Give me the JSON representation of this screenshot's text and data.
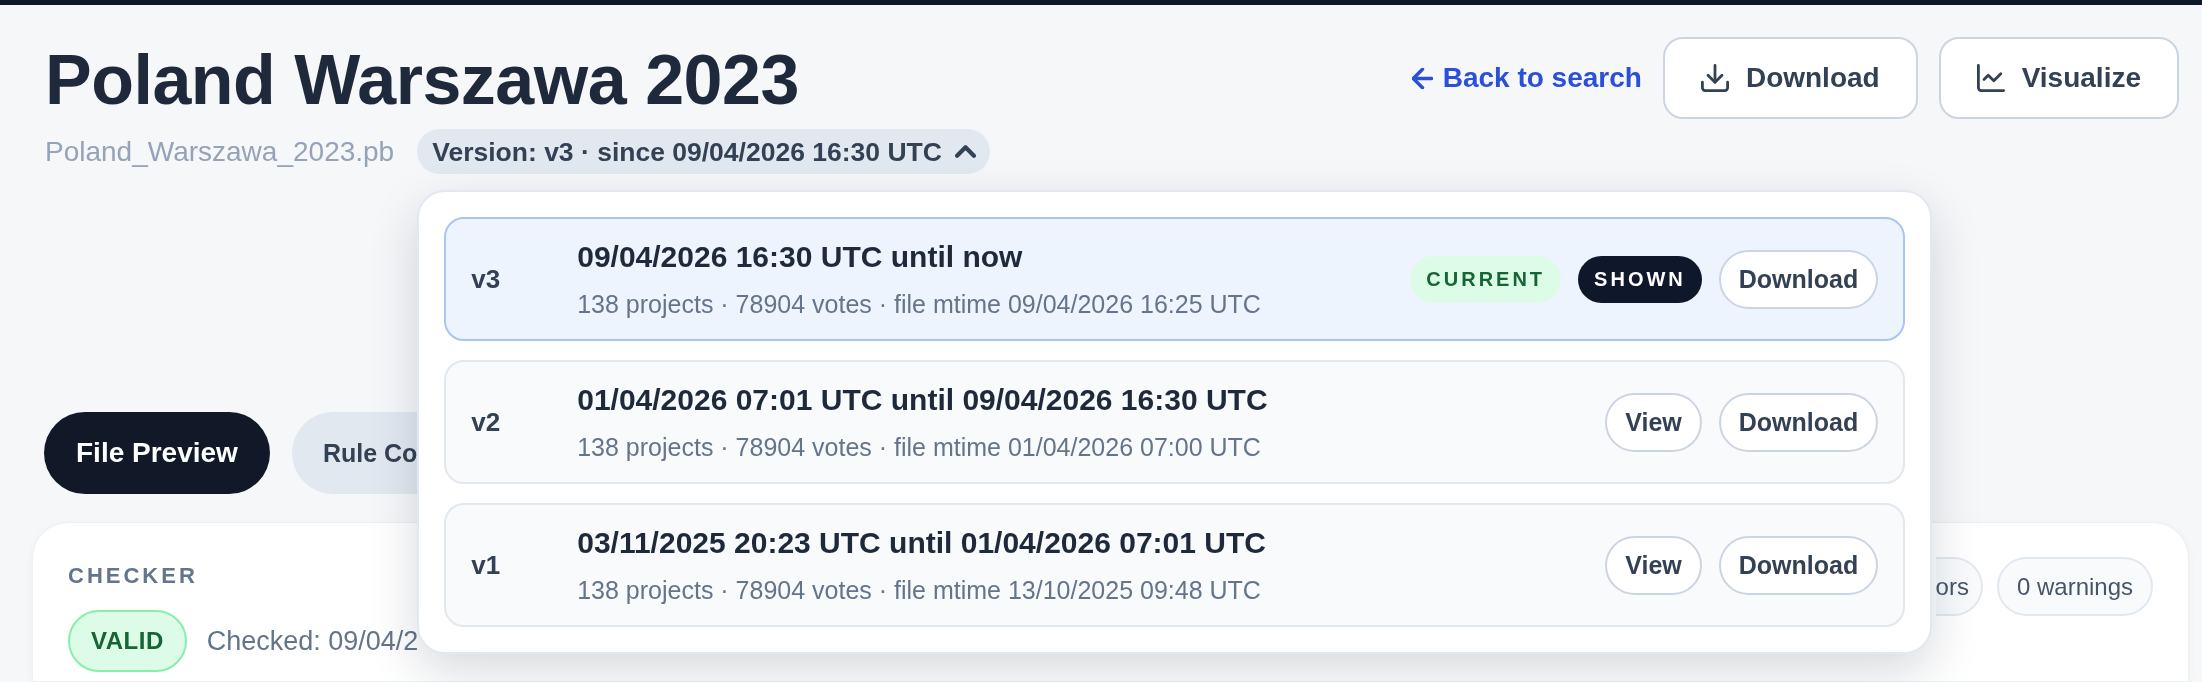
{
  "header": {
    "title": "Poland Warszawa 2023",
    "filename": "Poland_Warszawa_2023.pb",
    "back_link": "Back to search",
    "buttons": [
      {
        "kind": "download",
        "label": "Download"
      },
      {
        "kind": "visualize",
        "label": "Visualize"
      }
    ]
  },
  "version_menu": {
    "label": "Version: v3 · since 09/04/2026 16:30 UTC",
    "expanded": true,
    "versions": [
      {
        "label": "v3",
        "range": "09/04/2026 16:30 UTC until now",
        "details": "138 projects · 78904 votes · file mtime 09/04/2026 16:25 UTC",
        "selected": true,
        "badges": [
          {
            "kind": "current",
            "text": "CURRENT"
          },
          {
            "kind": "shown",
            "text": "SHOWN"
          }
        ],
        "download_label": "Download"
      },
      {
        "label": "v2",
        "range": "01/04/2026 07:01 UTC until 09/04/2026 16:30 UTC",
        "details": "138 projects · 78904 votes · file mtime 01/04/2026 07:00 UTC",
        "selected": false,
        "view_label": "View",
        "download_label": "Download"
      },
      {
        "label": "v1",
        "range": "03/11/2025 20:23 UTC until 01/04/2026 07:01 UTC",
        "details": "138 projects · 78904 votes · file mtime 13/10/2025 09:48 UTC",
        "selected": false,
        "view_label": "View",
        "download_label": "Download"
      }
    ]
  },
  "tabs": [
    {
      "label": "File Preview",
      "selected": true
    },
    {
      "label": "Rule Co",
      "selected": false
    }
  ],
  "checker": {
    "heading": "CHECKER",
    "status": {
      "kind": "valid",
      "text": "VALID"
    },
    "checked": "Checked: 09/04/2",
    "counts": [
      "ors",
      "0 warnings"
    ]
  }
}
